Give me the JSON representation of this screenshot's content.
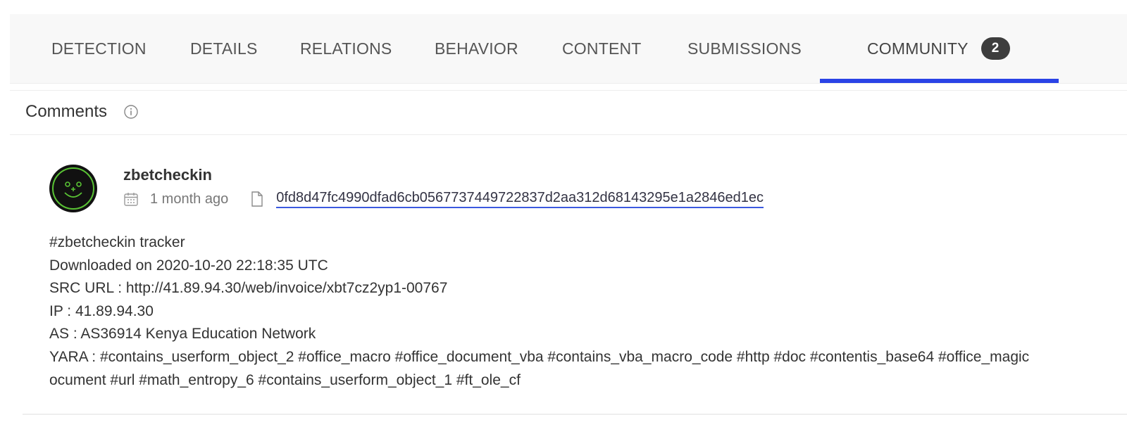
{
  "tabs": [
    {
      "label": "DETECTION"
    },
    {
      "label": "DETAILS"
    },
    {
      "label": "RELATIONS"
    },
    {
      "label": "BEHAVIOR"
    },
    {
      "label": "CONTENT"
    },
    {
      "label": "SUBMISSIONS"
    },
    {
      "label": "COMMUNITY",
      "badge": "2",
      "active": true
    }
  ],
  "comments_section": {
    "title": "Comments",
    "info_icon": "info-icon"
  },
  "comment": {
    "avatar_icon": "smiley-avatar-icon",
    "avatar_colors": {
      "background": "#111111",
      "ring": "#59c234"
    },
    "username": "zbetcheckin",
    "time": "1 month ago",
    "hash": "0fd8d47fc4990dfad6cb0567737449722837d2aa312d68143295e1a2846ed1ec",
    "lines": [
      "#zbetcheckin tracker",
      "Downloaded on 2020-10-20 22:18:35 UTC",
      "SRC URL : http://41.89.94.30/web/invoice/xbt7cz2yp1-00767",
      "IP : 41.89.94.30",
      "AS : AS36914 Kenya Education Network",
      "YARA : #contains_userform_object_2 #office_macro #office_document_vba #contains_vba_macro_code #http #doc #contentis_base64 #office_magic",
      "ocument #url #math_entropy_6 #contains_userform_object_1 #ft_ole_cf"
    ]
  },
  "colors": {
    "active_tab_underline": "#2a43e6",
    "link_underline": "#3b59e0",
    "badge_background": "#3d3d3d",
    "tab_bar_background": "#f8f8f8"
  }
}
